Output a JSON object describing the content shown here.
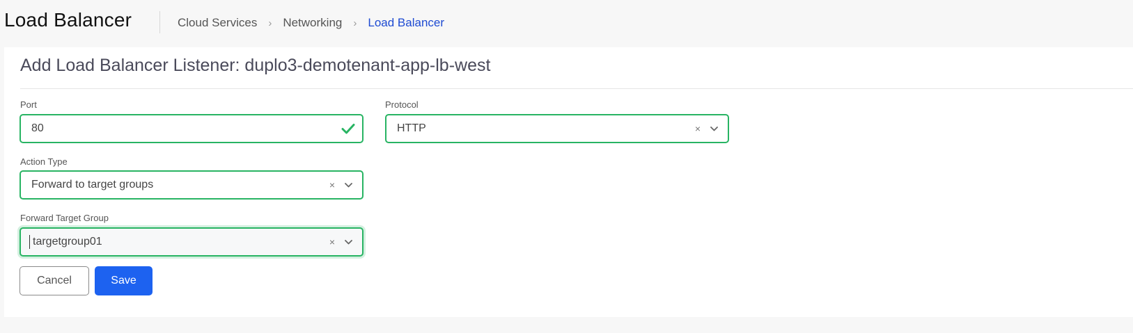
{
  "header": {
    "title": "Load Balancer",
    "breadcrumb": [
      "Cloud Services",
      "Networking",
      "Load Balancer"
    ]
  },
  "form": {
    "title": "Add Load Balancer Listener: duplo3-demotenant-app-lb-west",
    "port": {
      "label": "Port",
      "value": "80"
    },
    "protocol": {
      "label": "Protocol",
      "value": "HTTP"
    },
    "action_type": {
      "label": "Action Type",
      "value": "Forward to target groups"
    },
    "forward_target_group": {
      "label": "Forward Target Group",
      "value": "targetgroup01"
    },
    "cancel_label": "Cancel",
    "save_label": "Save",
    "clear_glyph": "×"
  },
  "colors": {
    "valid_border": "#28b463",
    "primary": "#1d62f0",
    "breadcrumb_active": "#1e4bd2"
  },
  "icons": [
    "check-icon",
    "clear-icon",
    "chevron-down-icon",
    "chevron-right-icon"
  ]
}
